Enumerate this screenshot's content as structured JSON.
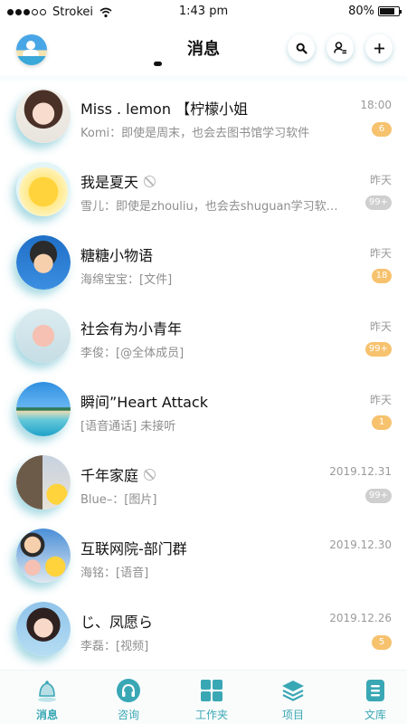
{
  "status_bar": {
    "signal_dots": 5,
    "signal_strength": 3,
    "carrier": "Strokei",
    "time": "1:43 pm",
    "battery": "80%",
    "battery_level": 0.8
  },
  "header": {
    "title": "消息",
    "icons": [
      "avatar-icon",
      "search-icon",
      "contacts-icon",
      "add-icon"
    ]
  },
  "conversations": [
    {
      "name": "Miss . lemon 【柠檬小姐",
      "preview": "Komi：即使是周末，也会去图书馆学习软件",
      "time": "18:00",
      "badge": "6",
      "badge_style": "orange",
      "muted": false
    },
    {
      "name": "我是夏天",
      "preview": "雪儿：即使是zhouliu，也会去shuguan学习软件…",
      "time": "昨天",
      "badge": "99+",
      "badge_style": "gray",
      "muted": true
    },
    {
      "name": "糖糖小物语",
      "preview": "海绵宝宝：[文件]",
      "time": "昨天",
      "badge": "18",
      "badge_style": "orange",
      "muted": false
    },
    {
      "name": "社会有为小青年",
      "preview": "李俊：[@全体成员]",
      "time": "昨天",
      "badge": "99+",
      "badge_style": "orange",
      "muted": false
    },
    {
      "name": "瞬间”Heart Attack",
      "preview": "[语音通话] 未接听",
      "time": "昨天",
      "badge": "1",
      "badge_style": "orange",
      "muted": false
    },
    {
      "name": "千年家庭",
      "preview": "Blue–：[图片]",
      "time": "2019.12.31",
      "badge": "99+",
      "badge_style": "gray",
      "muted": true
    },
    {
      "name": "互联网院-部门群",
      "preview": "海铭：[语音]",
      "time": "2019.12.30",
      "badge": "",
      "badge_style": "none",
      "muted": false
    },
    {
      "name": "じ、凤愿ら",
      "preview": "李磊：[视频]",
      "time": "2019.12.26",
      "badge": "5",
      "badge_style": "orange",
      "muted": false
    }
  ],
  "tabbar": {
    "tabs": [
      {
        "label": "消息",
        "icon": "bell-icon",
        "active": true
      },
      {
        "label": "咨询",
        "icon": "headset-icon",
        "active": false
      },
      {
        "label": "工作夹",
        "icon": "grid-icon",
        "active": false
      },
      {
        "label": "项目",
        "icon": "layers-icon",
        "active": false
      },
      {
        "label": "文库",
        "icon": "library-icon",
        "active": false
      }
    ]
  },
  "colors": {
    "accent": "#3aa7b5",
    "badge_orange": "#f6c26e",
    "badge_gray": "#cfcfcf",
    "preview_text": "#8e8e8e"
  }
}
